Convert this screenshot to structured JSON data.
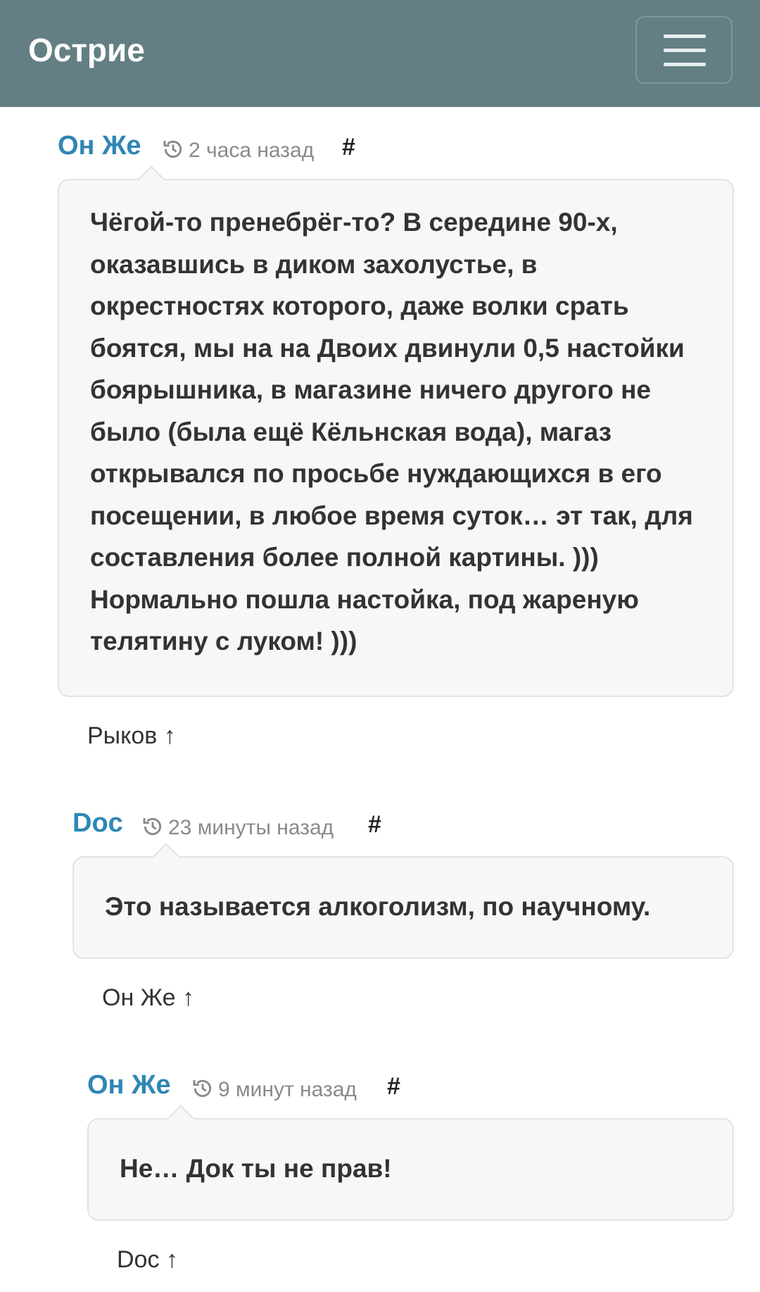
{
  "header": {
    "brand": "Острие",
    "menu_icon": "hamburger-icon"
  },
  "comments": [
    {
      "author": "Он Же",
      "time": "2 часа назад",
      "anchor": "#",
      "text": "Чёгой-то пренебрёг-то? В середине 90-х, оказавшись в диком захолустье, в окрестностях которого, даже волки срать боятся, мы на на Двоих двинули 0,5 настойки боярышника, в магазине ничего другого не было (была ещё Кёльнская вода), магаз открывался по просьбе нуждающихся в его посещении, в любое время суток… эт так, для составления более полной картины. ))) Нормально пошла настойка, под жареную телятину с луком! )))",
      "reply_to": "Рыков ↑"
    },
    {
      "author": "Doc",
      "time": "23 минуты назад",
      "anchor": "#",
      "text": "Это называется алкоголизм, по научному.",
      "reply_to": "Он Же ↑"
    },
    {
      "author": "Он Же",
      "time": "9 минут назад",
      "anchor": "#",
      "text": "Не… Док ты не прав!",
      "reply_to": "Doc ↑"
    }
  ],
  "colors": {
    "navbar": "#637f84",
    "author_link": "#2e86b5",
    "bubble_bg": "#f7f7f8"
  }
}
